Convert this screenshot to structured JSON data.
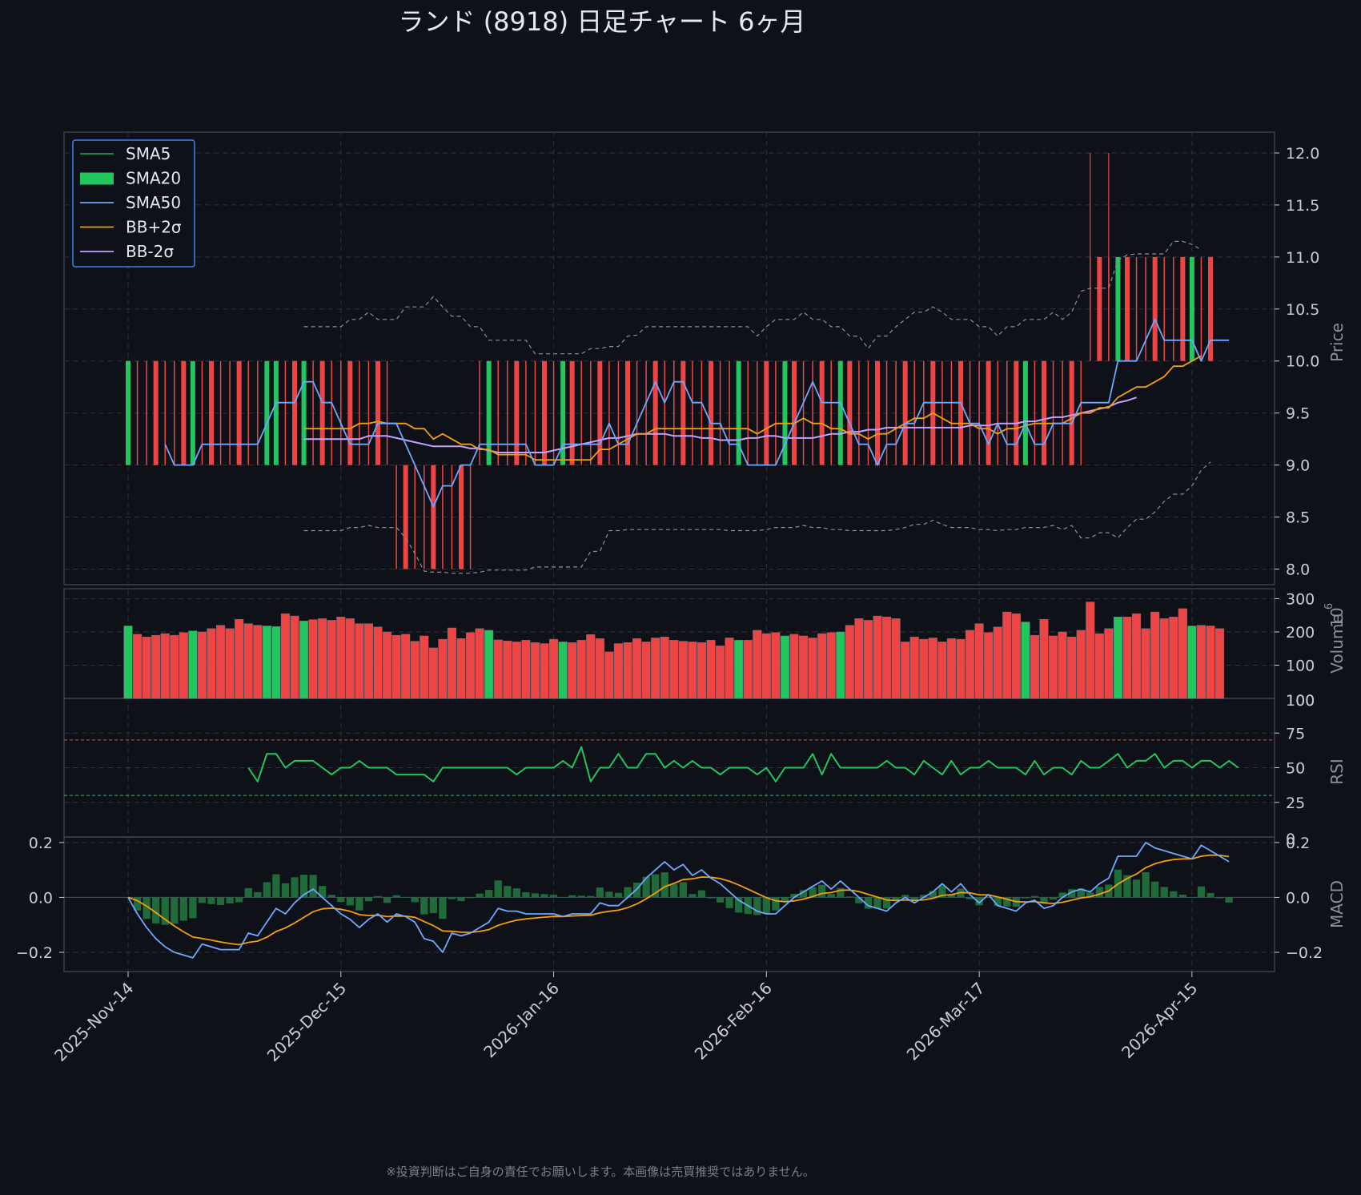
{
  "title": "ランド (8918)  日足チャート  6ヶ月",
  "footer": "※投資判断はご自身の責任でお願いします。本画像は売買推奨ではありません。",
  "colors": {
    "background": "#0e1117",
    "panel_border": "#3a3f4b",
    "grid": "#2e3340",
    "text": "#c9ccd3",
    "up": "#22c55e",
    "down": "#ef4444",
    "sma5": "#22c55e",
    "sma20": "#f59e0b",
    "sma50": "#6ea8fe",
    "bb_upper": "#f59e0b",
    "bb_lower": "#c4a0ff",
    "bb_band": "#8a8f9c",
    "macd_line": "#6ea8fe",
    "signal_line": "#f59e0b",
    "hist": "#1f6b3a",
    "legend_border": "#3b82f6"
  },
  "legend": [
    {
      "label": "SMA5",
      "style": "thin-line",
      "color": "#22c55e"
    },
    {
      "label": "SMA20",
      "style": "patch",
      "color": "#22c55e"
    },
    {
      "label": "SMA50",
      "style": "line",
      "color": "#6ea8fe"
    },
    {
      "label": "BB+2σ",
      "style": "line",
      "color": "#f59e0b"
    },
    {
      "label": "BB-2σ",
      "style": "line",
      "color": "#c4a0ff"
    }
  ],
  "x_ticks": [
    "2025-Nov-14",
    "2025-Dec-15",
    "2026-Jan-16",
    "2026-Feb-16",
    "2026-Mar-17",
    "2026-Apr-15"
  ],
  "panels": {
    "price": {
      "ylabel": "Price",
      "ticks": [
        "8.0",
        "8.5",
        "9.0",
        "9.5",
        "10.0",
        "10.5",
        "11.0",
        "11.5",
        "12.0"
      ]
    },
    "volume": {
      "ylabel": "Volume",
      "exponent": "1e6",
      "exp_base": "10",
      "exp_power": "6",
      "ticks": [
        "100",
        "200",
        "300"
      ],
      "bottom_label": "100"
    },
    "rsi": {
      "ylabel": "RSI",
      "ticks": [
        "25",
        "50",
        "75"
      ],
      "overbought": 70,
      "oversold": 30,
      "bottom_label": "0"
    },
    "macd": {
      "ylabel": "MACD",
      "ticks": [
        "0.2",
        "0.0",
        "−0.2"
      ],
      "left_ticks": [
        "0.2",
        "0.0",
        "−0.2"
      ]
    }
  },
  "chart_data": {
    "type": "line",
    "title": "ランド (8918)  日足チャート  6ヶ月",
    "x_start": "2025-11-14",
    "dates_note_visible": false,
    "n": 118,
    "price": {
      "ylim": [
        7.85,
        12.2
      ],
      "candles_bull": [
        1,
        0,
        0,
        0,
        0,
        0,
        0,
        1,
        0,
        0,
        0,
        0,
        0,
        0,
        0,
        1,
        1,
        0,
        0,
        1,
        0,
        0,
        0,
        0,
        0,
        0,
        0,
        0,
        0,
        0,
        0,
        0,
        0,
        0,
        0,
        0,
        0,
        0,
        0,
        1,
        0,
        0,
        0,
        0,
        0,
        0,
        0,
        1,
        0,
        0,
        0,
        0,
        0,
        0,
        0,
        0,
        0,
        0,
        0,
        0,
        0,
        0,
        0,
        0,
        0,
        0,
        1,
        0,
        0,
        0,
        0,
        1,
        0,
        0,
        0,
        0,
        0,
        1,
        0,
        0,
        0,
        0,
        0,
        0,
        0,
        0,
        0,
        0,
        0,
        0,
        0,
        0,
        0,
        0,
        0,
        0,
        0,
        1,
        0,
        0,
        0,
        0,
        0,
        0,
        0,
        0,
        0,
        1,
        0,
        0,
        0,
        0,
        0,
        0,
        0,
        1,
        0,
        0
      ],
      "sma5": [
        null,
        null,
        null,
        null,
        9.2,
        9.0,
        9.0,
        9.0,
        9.2,
        9.2,
        9.2,
        9.2,
        9.2,
        9.2,
        9.2,
        9.4,
        9.6,
        9.6,
        9.6,
        9.8,
        9.8,
        9.6,
        9.6,
        9.4,
        9.2,
        9.2,
        9.2,
        9.4,
        9.4,
        9.4,
        9.2,
        9.0,
        8.8,
        8.6,
        8.8,
        8.8,
        9.0,
        9.0,
        9.2,
        9.2,
        9.2,
        9.2,
        9.2,
        9.2,
        9.0,
        9.0,
        9.0,
        9.2,
        9.2,
        9.2,
        9.2,
        9.2,
        9.4,
        9.2,
        9.2,
        9.4,
        9.6,
        9.8,
        9.6,
        9.8,
        9.8,
        9.6,
        9.6,
        9.4,
        9.4,
        9.2,
        9.2,
        9.0,
        9.0,
        9.0,
        9.0,
        9.2,
        9.4,
        9.6,
        9.8,
        9.6,
        9.6,
        9.6,
        9.4,
        9.2,
        9.2,
        9.0,
        9.2,
        9.2,
        9.4,
        9.4,
        9.6,
        9.6,
        9.6,
        9.6,
        9.6,
        9.4,
        9.4,
        9.2,
        9.4,
        9.2,
        9.2,
        9.4,
        9.2,
        9.2,
        9.4,
        9.4,
        9.4,
        9.6,
        9.6,
        9.6,
        9.6,
        10.0,
        10.0,
        10.0,
        10.2,
        10.4,
        10.2,
        10.2,
        10.2,
        10.2,
        10.0,
        10.2,
        10.2,
        10.2
      ],
      "sma20": [
        null,
        null,
        null,
        null,
        null,
        null,
        null,
        null,
        null,
        null,
        null,
        null,
        null,
        null,
        null,
        null,
        null,
        null,
        null,
        9.35,
        9.35,
        9.35,
        9.35,
        9.35,
        9.35,
        9.4,
        9.4,
        9.42,
        9.4,
        9.4,
        9.4,
        9.35,
        9.35,
        9.25,
        9.3,
        9.25,
        9.2,
        9.2,
        9.15,
        9.15,
        9.1,
        9.1,
        9.1,
        9.1,
        9.05,
        9.05,
        9.05,
        9.05,
        9.05,
        9.05,
        9.05,
        9.15,
        9.15,
        9.2,
        9.25,
        9.3,
        9.3,
        9.35,
        9.35,
        9.35,
        9.35,
        9.35,
        9.35,
        9.35,
        9.35,
        9.35,
        9.35,
        9.35,
        9.3,
        9.35,
        9.4,
        9.4,
        9.4,
        9.45,
        9.4,
        9.4,
        9.35,
        9.35,
        9.3,
        9.3,
        9.25,
        9.3,
        9.3,
        9.35,
        9.4,
        9.45,
        9.45,
        9.5,
        9.45,
        9.4,
        9.4,
        9.4,
        9.35,
        9.35,
        9.3,
        9.35,
        9.35,
        9.38,
        9.4,
        9.4,
        9.4,
        9.4,
        9.45,
        9.5,
        9.5,
        9.55,
        9.55,
        9.65,
        9.7,
        9.75,
        9.75,
        9.8,
        9.85,
        9.95,
        9.95,
        10.0,
        10.05
      ],
      "bb_lower_line": [
        null,
        null,
        null,
        null,
        null,
        null,
        null,
        null,
        null,
        null,
        null,
        null,
        null,
        null,
        null,
        null,
        null,
        null,
        null,
        9.25,
        9.25,
        9.25,
        9.25,
        9.25,
        9.25,
        9.25,
        9.28,
        9.28,
        9.28,
        9.26,
        9.24,
        9.22,
        9.2,
        9.18,
        9.18,
        9.18,
        9.18,
        9.16,
        9.16,
        9.14,
        9.12,
        9.12,
        9.12,
        9.12,
        9.12,
        9.12,
        9.14,
        9.16,
        9.18,
        9.2,
        9.22,
        9.24,
        9.26,
        9.26,
        9.28,
        9.3,
        9.3,
        9.3,
        9.3,
        9.28,
        9.28,
        9.28,
        9.26,
        9.26,
        9.24,
        9.24,
        9.24,
        9.26,
        9.26,
        9.28,
        9.28,
        9.26,
        9.26,
        9.26,
        9.26,
        9.28,
        9.3,
        9.3,
        9.32,
        9.32,
        9.34,
        9.34,
        9.36,
        9.36,
        9.36,
        9.36,
        9.36,
        9.36,
        9.36,
        9.36,
        9.36,
        9.38,
        9.38,
        9.38,
        9.4,
        9.4,
        9.4,
        9.42,
        9.42,
        9.44,
        9.46,
        9.46,
        9.48,
        9.5,
        9.52,
        9.54,
        9.56,
        9.6,
        9.62,
        9.65
      ],
      "bb_upper_band": [
        null,
        null,
        null,
        null,
        null,
        null,
        null,
        null,
        null,
        null,
        null,
        null,
        null,
        null,
        null,
        null,
        null,
        null,
        null,
        10.33,
        10.33,
        10.33,
        10.33,
        10.33,
        10.4,
        10.4,
        10.47,
        10.4,
        10.4,
        10.4,
        10.52,
        10.52,
        10.52,
        10.62,
        10.52,
        10.43,
        10.43,
        10.33,
        10.33,
        10.2,
        10.2,
        10.2,
        10.2,
        10.2,
        10.07,
        10.07,
        10.07,
        10.07,
        10.07,
        10.07,
        10.12,
        10.12,
        10.14,
        10.14,
        10.24,
        10.25,
        10.33,
        10.33,
        10.33,
        10.33,
        10.33,
        10.33,
        10.33,
        10.33,
        10.33,
        10.33,
        10.33,
        10.33,
        10.24,
        10.33,
        10.4,
        10.4,
        10.4,
        10.47,
        10.4,
        10.4,
        10.33,
        10.33,
        10.24,
        10.24,
        10.12,
        10.24,
        10.24,
        10.33,
        10.4,
        10.47,
        10.47,
        10.52,
        10.47,
        10.4,
        10.4,
        10.4,
        10.33,
        10.33,
        10.24,
        10.33,
        10.33,
        10.4,
        10.4,
        10.4,
        10.47,
        10.4,
        10.47,
        10.67,
        10.7,
        10.7,
        10.7,
        10.97,
        11.02,
        11.03,
        11.03,
        11.03,
        11.03,
        11.15,
        11.15,
        11.12,
        11.07
      ],
      "bb_lower_band": [
        null,
        null,
        null,
        null,
        null,
        null,
        null,
        null,
        null,
        null,
        null,
        null,
        null,
        null,
        null,
        null,
        null,
        null,
        null,
        8.37,
        8.37,
        8.37,
        8.37,
        8.37,
        8.4,
        8.4,
        8.42,
        8.4,
        8.4,
        8.4,
        8.3,
        8.15,
        7.98,
        7.97,
        7.97,
        7.96,
        7.96,
        7.96,
        7.97,
        7.99,
        7.99,
        7.99,
        7.99,
        7.99,
        8.02,
        8.02,
        8.02,
        8.02,
        8.02,
        8.02,
        8.17,
        8.17,
        8.37,
        8.37,
        8.38,
        8.38,
        8.38,
        8.38,
        8.38,
        8.38,
        8.38,
        8.38,
        8.38,
        8.38,
        8.38,
        8.37,
        8.37,
        8.37,
        8.37,
        8.38,
        8.4,
        8.4,
        8.4,
        8.42,
        8.4,
        8.4,
        8.38,
        8.38,
        8.37,
        8.37,
        8.37,
        8.37,
        8.37,
        8.38,
        8.4,
        8.43,
        8.43,
        8.47,
        8.43,
        8.4,
        8.4,
        8.4,
        8.38,
        8.38,
        8.37,
        8.38,
        8.38,
        8.4,
        8.4,
        8.4,
        8.42,
        8.38,
        8.42,
        8.3,
        8.3,
        8.35,
        8.35,
        8.3,
        8.4,
        8.48,
        8.48,
        8.55,
        8.65,
        8.72,
        8.72,
        8.8,
        8.95,
        9.03
      ]
    },
    "volume_millions": [
      218,
      193,
      185,
      190,
      195,
      190,
      198,
      203,
      200,
      210,
      220,
      210,
      238,
      225,
      220,
      218,
      216,
      255,
      248,
      233,
      237,
      240,
      235,
      245,
      240,
      225,
      225,
      215,
      200,
      190,
      193,
      172,
      188,
      152,
      178,
      212,
      180,
      198,
      210,
      205,
      176,
      173,
      170,
      175,
      168,
      165,
      178,
      170,
      168,
      175,
      192,
      180,
      140,
      165,
      168,
      180,
      170,
      182,
      185,
      175,
      172,
      170,
      168,
      175,
      158,
      182,
      175,
      175,
      205,
      195,
      198,
      188,
      193,
      188,
      182,
      195,
      198,
      200,
      220,
      240,
      235,
      248,
      245,
      240,
      170,
      185,
      178,
      182,
      170,
      180,
      178,
      205,
      225,
      198,
      215,
      260,
      255,
      230,
      190,
      238,
      188,
      200,
      185,
      205,
      290,
      195,
      210,
      245,
      245,
      255,
      210,
      260,
      240,
      245,
      270,
      218,
      220,
      218,
      210
    ],
    "rsi": {
      "values": [
        null,
        null,
        null,
        null,
        null,
        null,
        null,
        null,
        null,
        null,
        null,
        null,
        null,
        50,
        40,
        60,
        60,
        50,
        55,
        55,
        55,
        50,
        45,
        50,
        50,
        55,
        50,
        50,
        50,
        45,
        45,
        45,
        45,
        40,
        50,
        50,
        50,
        50,
        50,
        50,
        50,
        50,
        45,
        50,
        50,
        50,
        50,
        55,
        50,
        65,
        40,
        50,
        50,
        60,
        50,
        50,
        60,
        60,
        50,
        55,
        50,
        55,
        50,
        50,
        45,
        50,
        50,
        50,
        45,
        50,
        40,
        50,
        50,
        50,
        60,
        45,
        60,
        50,
        50,
        50,
        50,
        50,
        55,
        50,
        50,
        45,
        55,
        50,
        45,
        55,
        45,
        50,
        50,
        55,
        50,
        50,
        50,
        45,
        55,
        45,
        50,
        50,
        45,
        55,
        50,
        50,
        55,
        60,
        50,
        55,
        55,
        60,
        50,
        55,
        55,
        50,
        55,
        55,
        50,
        55,
        50
      ]
    },
    "macd": {
      "ylim": [
        -0.27,
        0.22
      ],
      "macd": [
        0.0,
        -0.06,
        -0.11,
        -0.15,
        -0.18,
        -0.2,
        -0.21,
        -0.22,
        -0.17,
        -0.18,
        -0.19,
        -0.19,
        -0.19,
        -0.13,
        -0.14,
        -0.09,
        -0.04,
        -0.06,
        -0.02,
        0.01,
        0.03,
        0.0,
        -0.03,
        -0.06,
        -0.08,
        -0.11,
        -0.08,
        -0.06,
        -0.09,
        -0.06,
        -0.07,
        -0.09,
        -0.15,
        -0.16,
        -0.2,
        -0.13,
        -0.14,
        -0.13,
        -0.11,
        -0.09,
        -0.04,
        -0.05,
        -0.05,
        -0.06,
        -0.06,
        -0.06,
        -0.06,
        -0.07,
        -0.06,
        -0.06,
        -0.06,
        -0.02,
        -0.03,
        -0.03,
        0.0,
        0.03,
        0.07,
        0.1,
        0.13,
        0.1,
        0.12,
        0.08,
        0.1,
        0.07,
        0.05,
        0.02,
        -0.01,
        -0.03,
        -0.05,
        -0.06,
        -0.06,
        -0.03,
        0.0,
        0.02,
        0.04,
        0.06,
        0.03,
        0.06,
        0.03,
        0.0,
        -0.03,
        -0.04,
        -0.05,
        -0.02,
        0.0,
        -0.02,
        0.0,
        0.02,
        0.05,
        0.02,
        0.05,
        0.01,
        -0.02,
        0.01,
        -0.03,
        -0.04,
        -0.05,
        -0.02,
        -0.01,
        -0.04,
        -0.03,
        0.0,
        0.02,
        0.03,
        0.02,
        0.05,
        0.07,
        0.15,
        0.15,
        0.15,
        0.2,
        0.18,
        0.17,
        0.16,
        0.15,
        0.14,
        0.19,
        0.17,
        0.15,
        0.13
      ]
    }
  }
}
